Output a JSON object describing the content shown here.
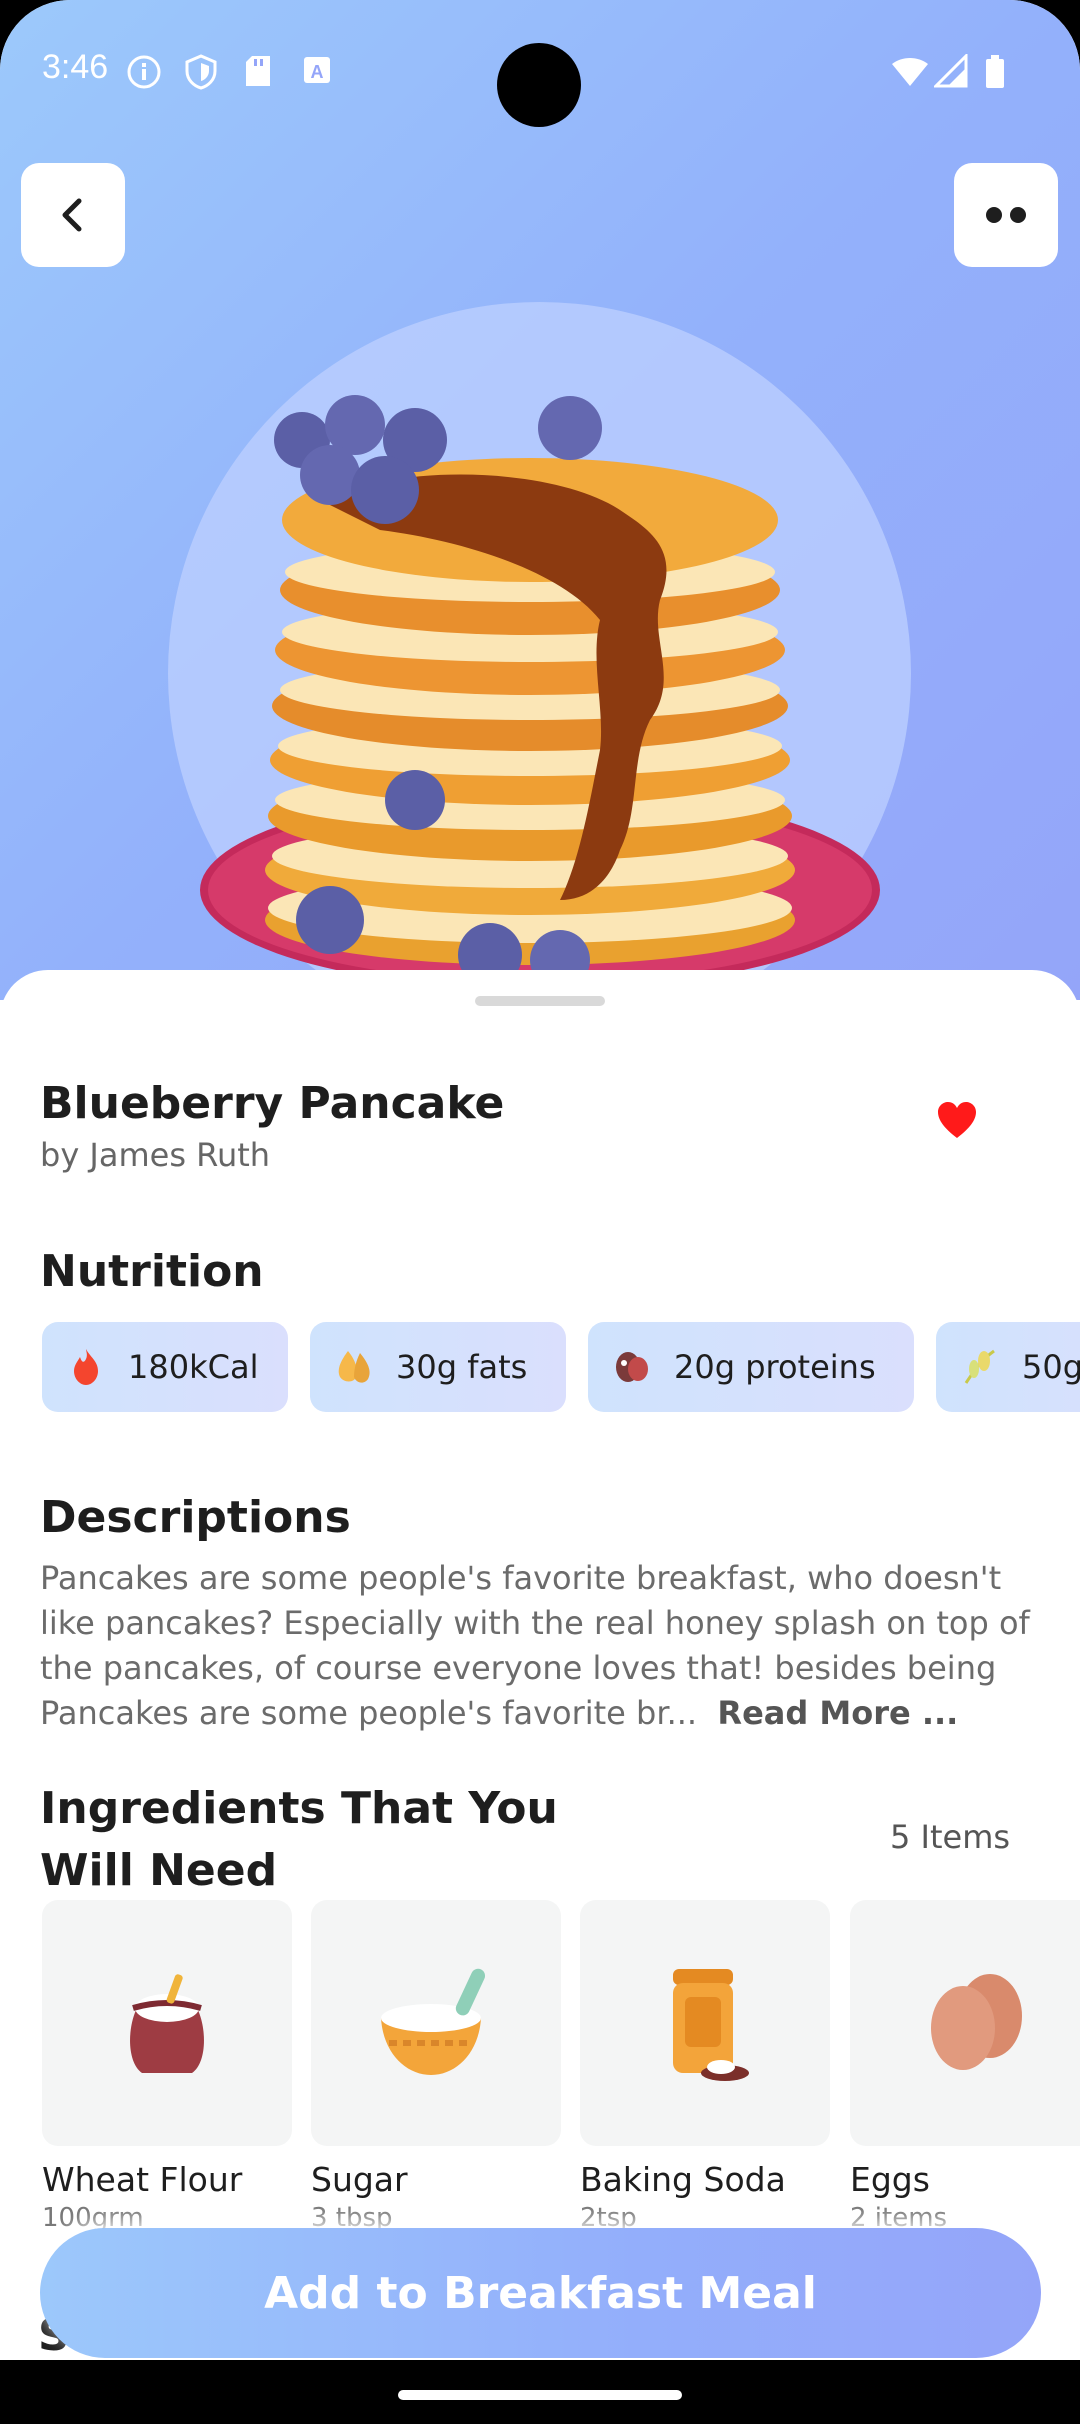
{
  "status_bar": {
    "time": "3:46",
    "icons": [
      "info-icon",
      "shield-icon",
      "sd-card-icon",
      "keyboard-icon",
      "wifi-icon",
      "signal-icon",
      "battery-icon"
    ]
  },
  "header": {
    "back_icon": "chevron-left-icon",
    "more_icon": "more-dots-icon"
  },
  "recipe": {
    "title": "Blueberry Pancake",
    "author": "by James Ruth",
    "favorite": true,
    "favorite_color": "#ff1a1a"
  },
  "nutrition": {
    "title": "Nutrition",
    "chips": [
      {
        "icon": "fire-icon",
        "label": "180kCal"
      },
      {
        "icon": "fat-drop-icon",
        "label": "30g fats"
      },
      {
        "icon": "protein-icon",
        "label": "20g proteins"
      },
      {
        "icon": "carbs-icon",
        "label": "50g"
      }
    ]
  },
  "description": {
    "title": "Descriptions",
    "text": "Pancakes are some people's favorite breakfast, who doesn't like pancakes? Especially with the real honey splash on top of the pancakes, of course everyone loves that! besides being Pancakes are some people's favorite br...",
    "read_more": "Read More ..."
  },
  "ingredients": {
    "title": "Ingredients That You Will Need",
    "count": "5 Items",
    "items": [
      {
        "name": "Wheat Flour",
        "qty": "100grm",
        "icon": "flour-sack-icon"
      },
      {
        "name": "Sugar",
        "qty": "3 tbsp",
        "icon": "sugar-bowl-icon"
      },
      {
        "name": "Baking Soda",
        "qty": "2tsp",
        "icon": "baking-soda-jar-icon"
      },
      {
        "name": "Eggs",
        "qty": "2 items",
        "icon": "eggs-icon"
      }
    ]
  },
  "cta": {
    "label": "Add to Breakfast Meal"
  },
  "peek_text": "S",
  "colors": {
    "accent_start": "#9cc8fb",
    "accent_end": "#94a5f9",
    "chip_bg": "#d4e1fd"
  }
}
